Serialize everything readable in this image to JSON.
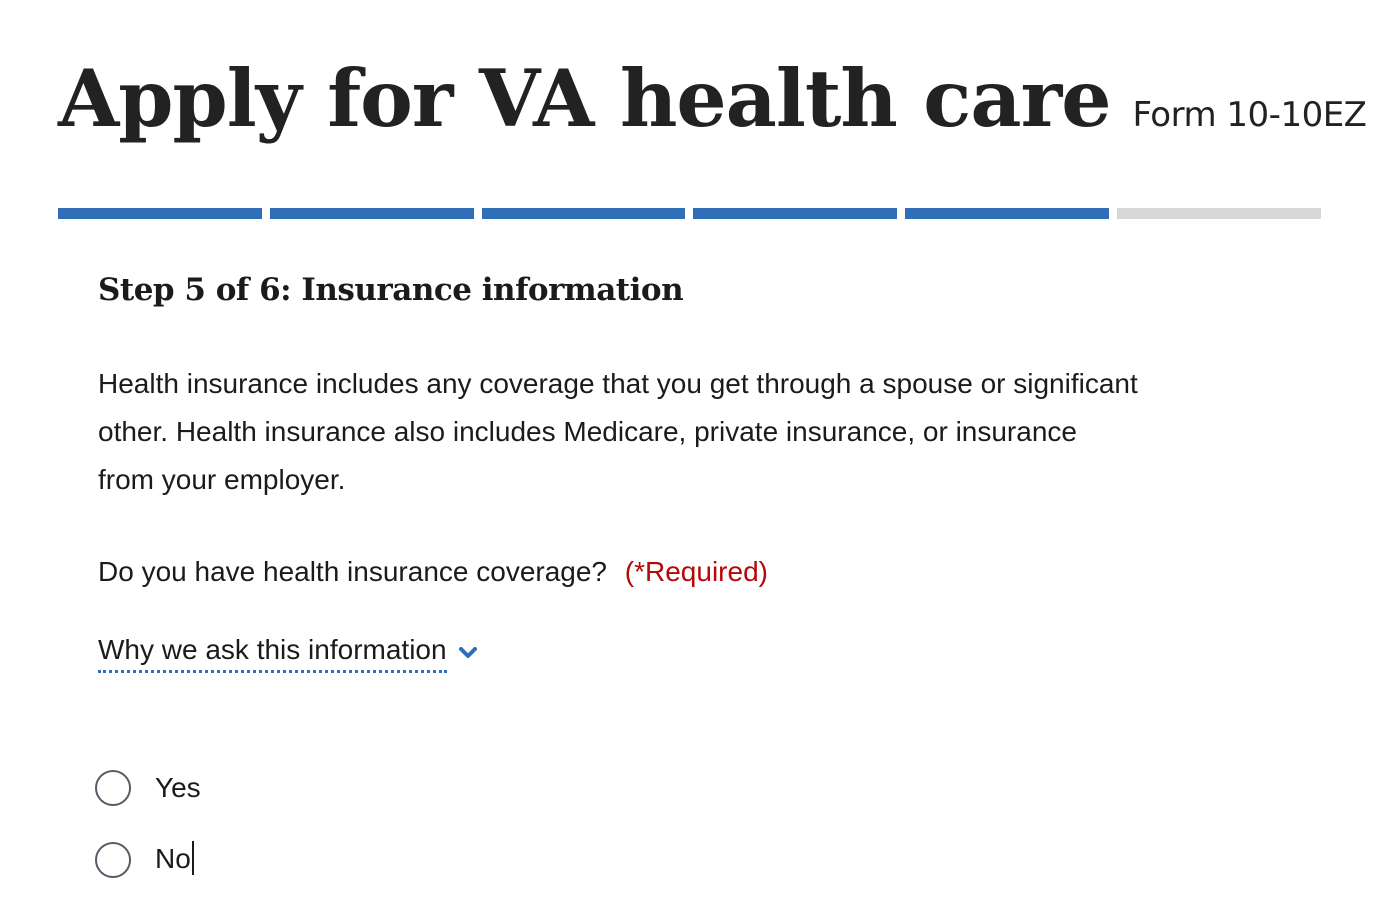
{
  "header": {
    "title": "Apply for VA health care",
    "form_number": "Form 10-10EZ"
  },
  "progress": {
    "total_steps": 6,
    "completed_steps": 5,
    "active_color": "#2e6fb7",
    "inactive_color": "#d6d7d9"
  },
  "step": {
    "heading": "Step 5 of 6: Insurance information",
    "description": "Health insurance includes any coverage that you get through a spouse or significant other. Health insurance also includes Medicare, private insurance, or insurance from your employer."
  },
  "question": {
    "label": "Do you have health insurance coverage?",
    "required_label": "(*Required)",
    "why_link": "Why we ask this information",
    "chevron_icon": "chevron-down-icon",
    "options": [
      {
        "label": "Yes",
        "selected": false
      },
      {
        "label": "No",
        "selected": false
      }
    ]
  }
}
